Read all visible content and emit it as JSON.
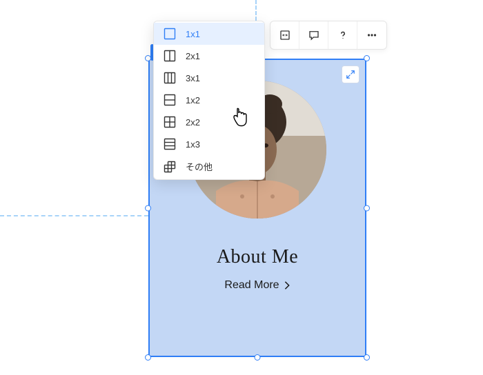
{
  "toolbar": {
    "stretch_icon": "stretch-icon",
    "comment_icon": "comment-icon",
    "help_icon": "help-icon",
    "more_icon": "more-icon"
  },
  "dropdown": {
    "items": [
      {
        "label": "1x1"
      },
      {
        "label": "2x1"
      },
      {
        "label": "3x1"
      },
      {
        "label": "1x2"
      },
      {
        "label": "2x2"
      },
      {
        "label": "1x3"
      },
      {
        "label": "その他"
      }
    ]
  },
  "card": {
    "title": "About Me",
    "readmore": "Read More"
  }
}
